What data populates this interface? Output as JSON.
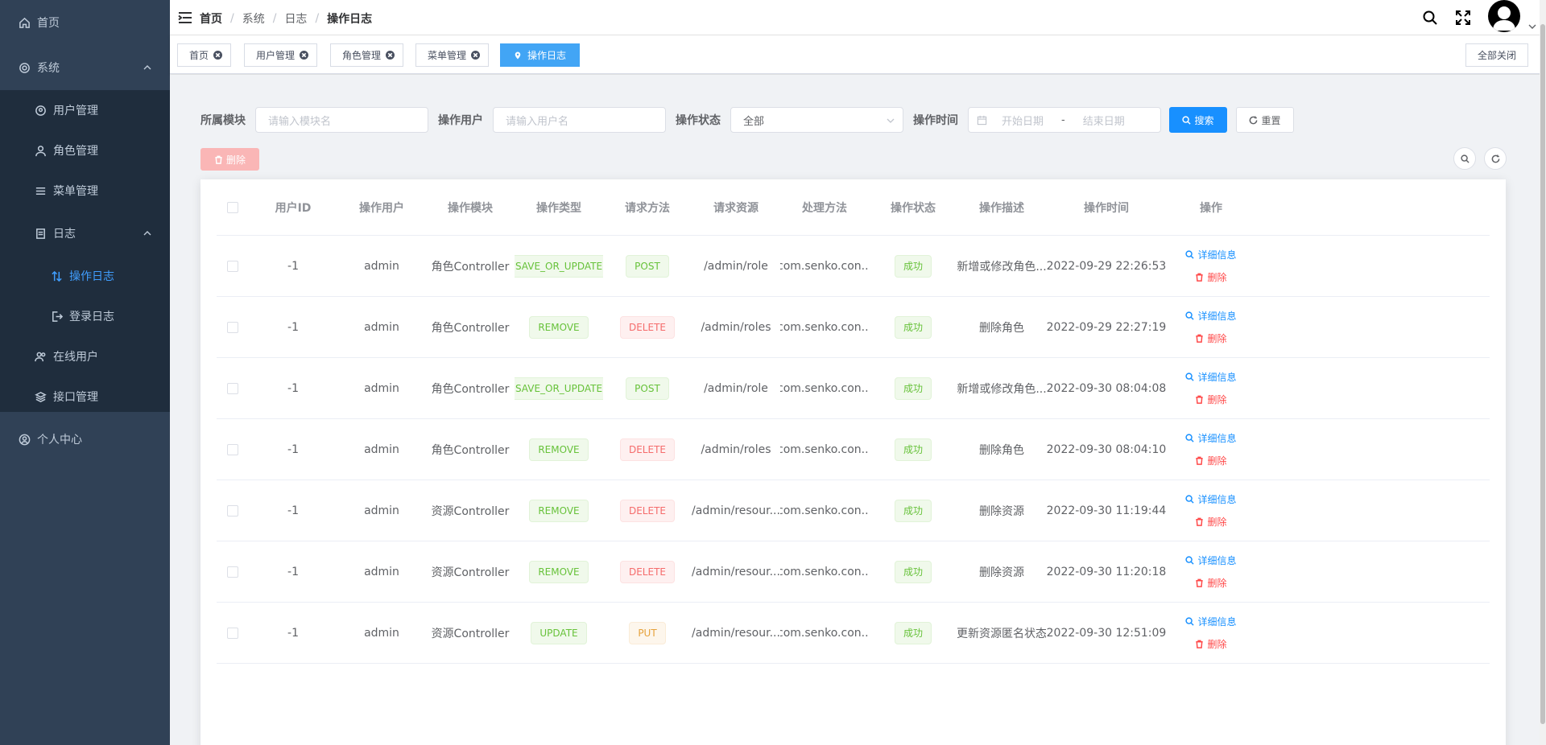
{
  "sidebar": {
    "items": [
      {
        "label": "首页",
        "icon": "home-icon"
      },
      {
        "label": "系统",
        "icon": "gear-icon"
      },
      {
        "label": "用户管理",
        "icon": "user-circle-icon"
      },
      {
        "label": "角色管理",
        "icon": "person-icon"
      },
      {
        "label": "菜单管理",
        "icon": "list-icon"
      },
      {
        "label": "日志",
        "icon": "document-icon"
      },
      {
        "label": "操作日志",
        "icon": "sort-icon"
      },
      {
        "label": "登录日志",
        "icon": "logout-icon"
      },
      {
        "label": "在线用户",
        "icon": "users-icon"
      },
      {
        "label": "接口管理",
        "icon": "layers-icon"
      },
      {
        "label": "个人中心",
        "icon": "user-circle-icon"
      }
    ],
    "background": "#304156",
    "active_color": "#409eff"
  },
  "header": {
    "breadcrumb": [
      "首页",
      "系统",
      "日志",
      "操作日志"
    ]
  },
  "tags": {
    "items": [
      "首页",
      "用户管理",
      "角色管理",
      "菜单管理",
      "操作日志"
    ],
    "close_all": "全部关闭",
    "active_color": "#42a5f5"
  },
  "search": {
    "module_label": "所属模块",
    "module_placeholder": "请输入模块名",
    "user_label": "操作用户",
    "user_placeholder": "请输入用户名",
    "status_label": "操作状态",
    "status_value": "全部",
    "time_label": "操作时间",
    "start_placeholder": "开始日期",
    "range_sep": "-",
    "end_placeholder": "结束日期",
    "search_btn": "搜索",
    "reset_btn": "重置",
    "delete_btn": "删除"
  },
  "table": {
    "columns": [
      "用户ID",
      "操作用户",
      "操作模块",
      "操作类型",
      "请求方法",
      "请求资源",
      "处理方法",
      "操作状态",
      "操作描述",
      "操作时间",
      "操作"
    ],
    "detail_label": "详细信息",
    "delete_label": "删除",
    "rows": [
      {
        "id": "-1",
        "user": "admin",
        "module": "角色Controller",
        "type": "SAVE_OR_UPDATE",
        "method": "POST",
        "resource": "/admin/role",
        "handler": "com.senko.con...",
        "status": "成功",
        "desc": "新增或修改角色...",
        "time": "2022-09-29 22:26:53"
      },
      {
        "id": "-1",
        "user": "admin",
        "module": "角色Controller",
        "type": "REMOVE",
        "method": "DELETE",
        "resource": "/admin/roles",
        "handler": "com.senko.con...",
        "status": "成功",
        "desc": "删除角色",
        "time": "2022-09-29 22:27:19"
      },
      {
        "id": "-1",
        "user": "admin",
        "module": "角色Controller",
        "type": "SAVE_OR_UPDATE",
        "method": "POST",
        "resource": "/admin/role",
        "handler": "com.senko.con...",
        "status": "成功",
        "desc": "新增或修改角色...",
        "time": "2022-09-30 08:04:08"
      },
      {
        "id": "-1",
        "user": "admin",
        "module": "角色Controller",
        "type": "REMOVE",
        "method": "DELETE",
        "resource": "/admin/roles",
        "handler": "com.senko.con...",
        "status": "成功",
        "desc": "删除角色",
        "time": "2022-09-30 08:04:10"
      },
      {
        "id": "-1",
        "user": "admin",
        "module": "资源Controller",
        "type": "REMOVE",
        "method": "DELETE",
        "resource": "/admin/resour...",
        "handler": "com.senko.con...",
        "status": "成功",
        "desc": "删除资源",
        "time": "2022-09-30 11:19:44"
      },
      {
        "id": "-1",
        "user": "admin",
        "module": "资源Controller",
        "type": "REMOVE",
        "method": "DELETE",
        "resource": "/admin/resour...",
        "handler": "com.senko.con...",
        "status": "成功",
        "desc": "删除资源",
        "time": "2022-09-30 11:20:18"
      },
      {
        "id": "-1",
        "user": "admin",
        "module": "资源Controller",
        "type": "UPDATE",
        "method": "PUT",
        "resource": "/admin/resour...",
        "handler": "com.senko.con...",
        "status": "成功",
        "desc": "更新资源匿名状态",
        "time": "2022-09-30 12:51:09"
      }
    ]
  },
  "colors": {
    "primary": "#1890ff",
    "success": "#67c23a",
    "danger": "#f56c6c",
    "warning": "#e6a23c"
  }
}
